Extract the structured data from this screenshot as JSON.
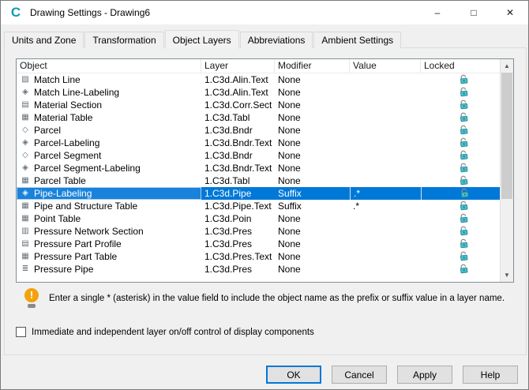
{
  "window": {
    "title": "Drawing Settings - Drawing6",
    "app_icon_glyph": "C",
    "controls": {
      "minimize": "–",
      "maximize": "□",
      "close": "✕"
    }
  },
  "tabs": [
    {
      "label": "Units and Zone",
      "active": false
    },
    {
      "label": "Transformation",
      "active": false
    },
    {
      "label": "Object Layers",
      "active": true
    },
    {
      "label": "Abbreviations",
      "active": false
    },
    {
      "label": "Ambient Settings",
      "active": false
    }
  ],
  "table": {
    "columns": [
      "Object",
      "Layer",
      "Modifier",
      "Value",
      "Locked"
    ],
    "rows": [
      {
        "object": "Match Line",
        "layer": "1.C3d.Alin.Text",
        "modifier": "None",
        "value": "",
        "locked": true,
        "selected": false,
        "icon": "match-line-icon",
        "glyph": "▨"
      },
      {
        "object": "Match Line-Labeling",
        "layer": "1.C3d.Alin.Text",
        "modifier": "None",
        "value": "",
        "locked": true,
        "selected": false,
        "icon": "match-line-labeling-icon",
        "glyph": "◈"
      },
      {
        "object": "Material Section",
        "layer": "1.C3d.Corr.Sect",
        "modifier": "None",
        "value": "",
        "locked": true,
        "selected": false,
        "icon": "material-section-icon",
        "glyph": "▤"
      },
      {
        "object": "Material Table",
        "layer": "1.C3d.Tabl",
        "modifier": "None",
        "value": "",
        "locked": true,
        "selected": false,
        "icon": "material-table-icon",
        "glyph": "▦"
      },
      {
        "object": "Parcel",
        "layer": "1.C3d.Bndr",
        "modifier": "None",
        "value": "",
        "locked": true,
        "selected": false,
        "icon": "parcel-icon",
        "glyph": "◇"
      },
      {
        "object": "Parcel-Labeling",
        "layer": "1.C3d.Bndr.Text",
        "modifier": "None",
        "value": "",
        "locked": true,
        "selected": false,
        "icon": "parcel-labeling-icon",
        "glyph": "◈"
      },
      {
        "object": "Parcel Segment",
        "layer": "1.C3d.Bndr",
        "modifier": "None",
        "value": "",
        "locked": true,
        "selected": false,
        "icon": "parcel-segment-icon",
        "glyph": "◇"
      },
      {
        "object": "Parcel Segment-Labeling",
        "layer": "1.C3d.Bndr.Text",
        "modifier": "None",
        "value": "",
        "locked": true,
        "selected": false,
        "icon": "parcel-segment-labeling-icon",
        "glyph": "◈"
      },
      {
        "object": "Parcel Table",
        "layer": "1.C3d.Tabl",
        "modifier": "None",
        "value": "",
        "locked": true,
        "selected": false,
        "icon": "parcel-table-icon",
        "glyph": "▦"
      },
      {
        "object": "Pipe-Labeling",
        "layer": "1.C3d.Pipe",
        "modifier": "Suffix",
        "value": ".*",
        "locked": true,
        "selected": true,
        "icon": "pipe-labeling-icon",
        "glyph": "◈"
      },
      {
        "object": "Pipe and Structure Table",
        "layer": "1.C3d.Pipe.Text",
        "modifier": "Suffix",
        "value": ".*",
        "locked": true,
        "selected": false,
        "icon": "pipe-and-structure-table-icon",
        "glyph": "▦"
      },
      {
        "object": "Point Table",
        "layer": "1.C3d.Poin",
        "modifier": "None",
        "value": "",
        "locked": true,
        "selected": false,
        "icon": "point-table-icon",
        "glyph": "▦"
      },
      {
        "object": "Pressure Network Section",
        "layer": "1.C3d.Pres",
        "modifier": "None",
        "value": "",
        "locked": true,
        "selected": false,
        "icon": "pressure-network-section-icon",
        "glyph": "▥"
      },
      {
        "object": "Pressure Part Profile",
        "layer": "1.C3d.Pres",
        "modifier": "None",
        "value": "",
        "locked": true,
        "selected": false,
        "icon": "pressure-part-profile-icon",
        "glyph": "▤"
      },
      {
        "object": "Pressure Part Table",
        "layer": "1.C3d.Pres.Text",
        "modifier": "None",
        "value": "",
        "locked": true,
        "selected": false,
        "icon": "pressure-part-table-icon",
        "glyph": "▦"
      },
      {
        "object": "Pressure Pipe",
        "layer": "1.C3d.Pres",
        "modifier": "None",
        "value": "",
        "locked": true,
        "selected": false,
        "icon": "pressure-pipe-icon",
        "glyph": "≣"
      }
    ]
  },
  "scrollbar": {
    "up": "▲",
    "down": "▼"
  },
  "note": {
    "icon_glyph": "!",
    "text": "Enter a single * (asterisk) in the value field to include the object name as the prefix or suffix value in a layer name."
  },
  "checkbox": {
    "label": "Immediate and independent layer on/off control of display components",
    "checked": false
  },
  "buttons": [
    {
      "label": "OK",
      "default": true
    },
    {
      "label": "Cancel",
      "default": false
    },
    {
      "label": "Apply",
      "default": false
    },
    {
      "label": "Help",
      "default": false
    }
  ],
  "colors": {
    "accent": "#0078d7",
    "lock_teal": "#49c0cd",
    "warning_orange": "#f2a20d"
  }
}
